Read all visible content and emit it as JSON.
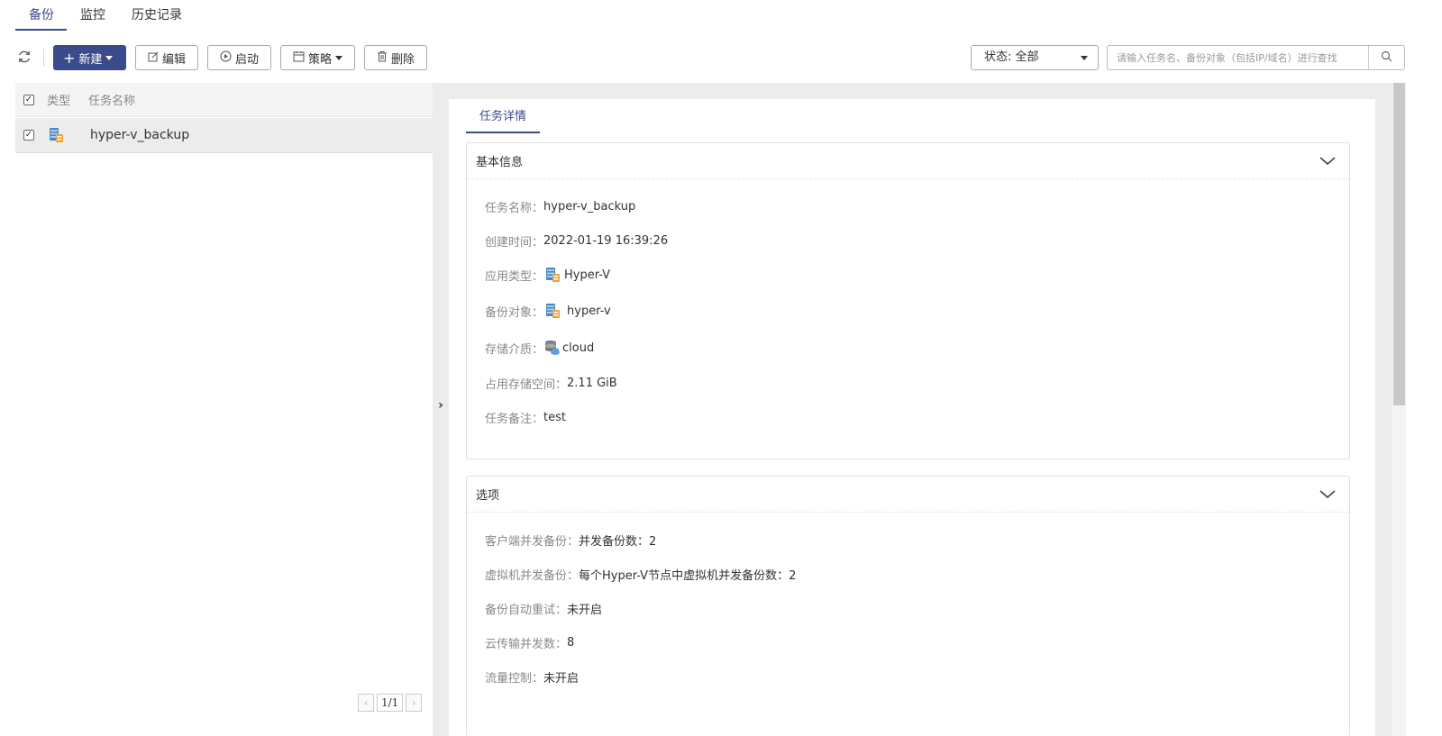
{
  "tabs": [
    {
      "label": "备份",
      "active": true
    },
    {
      "label": "监控",
      "active": false
    },
    {
      "label": "历史记录",
      "active": false
    }
  ],
  "toolbar": {
    "new_label": "新建",
    "edit_label": "编辑",
    "start_label": "启动",
    "policy_label": "策略",
    "delete_label": "删除"
  },
  "filter": {
    "status_value": "状态: 全部",
    "search_placeholder": "请输入任务名、备份对象（包括IP/域名）进行查找"
  },
  "list": {
    "columns": {
      "type": "类型",
      "name": "任务名称"
    },
    "rows": [
      {
        "name": "hyper-v_backup",
        "checked": true,
        "type_icon": "hyper-v-icon"
      }
    ],
    "pager": "1/1"
  },
  "detail": {
    "tab_label": "任务详情",
    "basic": {
      "title": "基本信息",
      "fields": [
        {
          "label": "任务名称：",
          "value": "hyper-v_backup"
        },
        {
          "label": "创建时间：",
          "value": "2022-01-19 16:39:26"
        },
        {
          "label": "应用类型：",
          "value": "Hyper-V"
        },
        {
          "label": "备份对象：",
          "value": "hyper-v"
        },
        {
          "label": "存储介质：",
          "value": "cloud"
        },
        {
          "label": "占用存储空间：",
          "value": "2.11 GiB"
        },
        {
          "label": "任务备注：",
          "value": "test"
        }
      ]
    },
    "options": {
      "title": "选项",
      "fields": [
        {
          "label": "客户端并发备份：",
          "value": "并发备份数：2"
        },
        {
          "label": "虚拟机并发备份：",
          "value": "每个Hyper-V节点中虚拟机并发备份数：2"
        },
        {
          "label": "备份自动重试：",
          "value": "未开启"
        },
        {
          "label": "云传输并发数：",
          "value": "8"
        },
        {
          "label": "流量控制：",
          "value": "未开启"
        }
      ]
    }
  },
  "colors": {
    "accent": "#3b4a8c"
  }
}
